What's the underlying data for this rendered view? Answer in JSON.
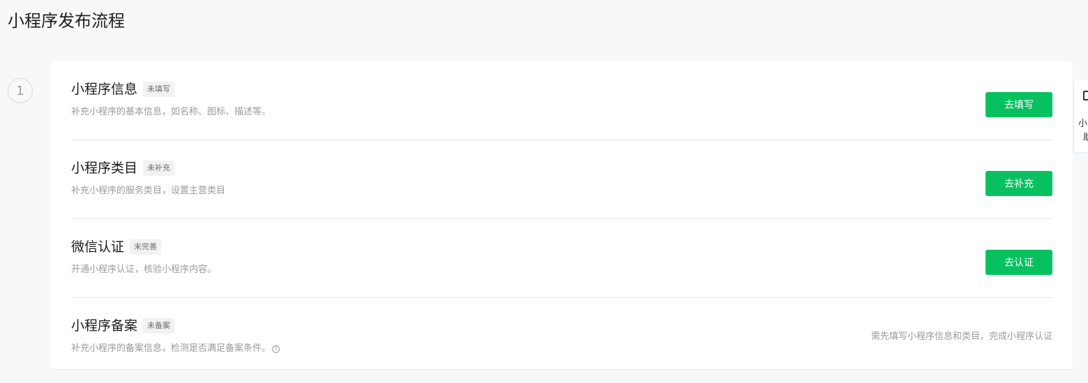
{
  "page": {
    "title": "小程序发布流程"
  },
  "step": {
    "number": "1"
  },
  "steps": [
    {
      "title": "小程序信息",
      "status": "未填写",
      "description": "补充小程序的基本信息，如名称、图标、描述等。",
      "button_label": "去填写"
    },
    {
      "title": "小程序类目",
      "status": "未补充",
      "description": "补充小程序的服务类目，设置主营类目",
      "button_label": "去补充"
    },
    {
      "title": "微信认证",
      "status": "未完善",
      "description": "开通小程序认证，核验小程序内容。",
      "button_label": "去认证"
    },
    {
      "title": "小程序备案",
      "status": "未备案",
      "description": "补充小程序的备案信息，检测是否满足备案条件。",
      "hint": "需先填写小程序信息和类目，完成小程序认证"
    }
  ],
  "side_widget": {
    "line1": "小",
    "line2": "助"
  },
  "colors": {
    "accent": "#07c160",
    "background": "#f7f8fa",
    "card": "#ffffff",
    "muted_text": "#9a9a9a"
  }
}
